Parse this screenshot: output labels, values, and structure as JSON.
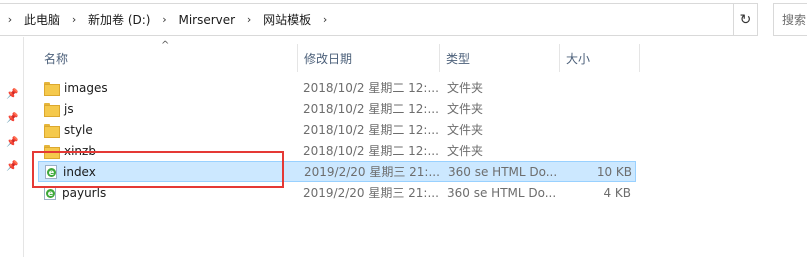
{
  "address": {
    "crumbs": [
      "此电脑",
      "新加卷 (D:)",
      "Mirserver",
      "网站模板"
    ],
    "search_placeholder": "搜索\"网站模板\""
  },
  "columns": {
    "name": "名称",
    "date": "修改日期",
    "type": "类型",
    "size": "大小"
  },
  "files": [
    {
      "name": "images",
      "date": "2018/10/2 星期二 12:...",
      "type": "文件夹",
      "size": "",
      "icon": "folder-icon"
    },
    {
      "name": "js",
      "date": "2018/10/2 星期二 12:...",
      "type": "文件夹",
      "size": "",
      "icon": "folder-icon"
    },
    {
      "name": "style",
      "date": "2018/10/2 星期二 12:...",
      "type": "文件夹",
      "size": "",
      "icon": "folder-icon"
    },
    {
      "name": "xinzb",
      "date": "2018/10/2 星期二 12:...",
      "type": "文件夹",
      "size": "",
      "icon": "folder-icon"
    },
    {
      "name": "index",
      "date": "2019/2/20 星期三 21:...",
      "type": "360 se HTML Do...",
      "size": "10 KB",
      "icon": "html-file-icon",
      "selected": true
    },
    {
      "name": "payurls",
      "date": "2019/2/20 星期三 21:...",
      "type": "360 se HTML Do...",
      "size": "4 KB",
      "icon": "html-file-icon"
    }
  ],
  "colors": {
    "selection_bg": "#cce8ff",
    "selection_border": "#99d1ff",
    "highlight_box": "#e53935"
  }
}
